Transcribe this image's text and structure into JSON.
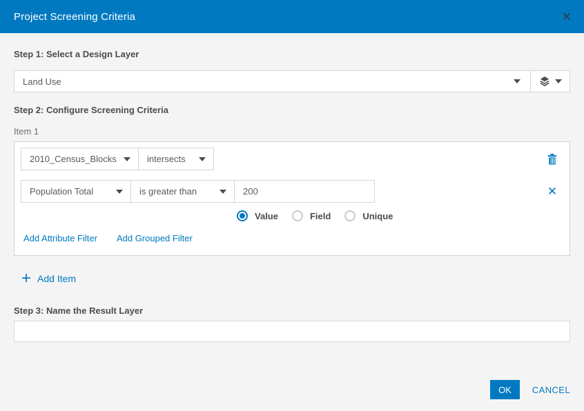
{
  "dialog": {
    "title": "Project Screening Criteria",
    "close_glyph": "✕"
  },
  "step1": {
    "label": "Step 1: Select a Design Layer",
    "layer_select_value": "Land Use"
  },
  "step2": {
    "label": "Step 2: Configure Screening Criteria",
    "item_label": "Item 1",
    "screen_row": {
      "layer_value": "2010_Census_Blocks",
      "operator_value": "intersects"
    },
    "filter_row": {
      "field_value": "Population Total",
      "operator_value": "is greater than",
      "value": "200",
      "remove_glyph": "✕"
    },
    "radios": [
      {
        "label": "Value",
        "selected": true
      },
      {
        "label": "Field",
        "selected": false
      },
      {
        "label": "Unique",
        "selected": false
      }
    ],
    "links": {
      "add_attribute_filter": "Add Attribute Filter",
      "add_grouped_filter": "Add Grouped Filter"
    },
    "add_item": {
      "plus_glyph": "+",
      "label": "Add Item"
    }
  },
  "step3": {
    "label": "Step 3: Name the Result Layer",
    "input_value": "",
    "input_placeholder": ""
  },
  "footer": {
    "ok_label": "OK",
    "cancel_label": "CANCEL"
  },
  "colors": {
    "header": "#0079c1",
    "accent": "#0079c1",
    "background": "#f4f4f4",
    "border": "#d5d5d5",
    "label_text": "#4c4c4c"
  }
}
